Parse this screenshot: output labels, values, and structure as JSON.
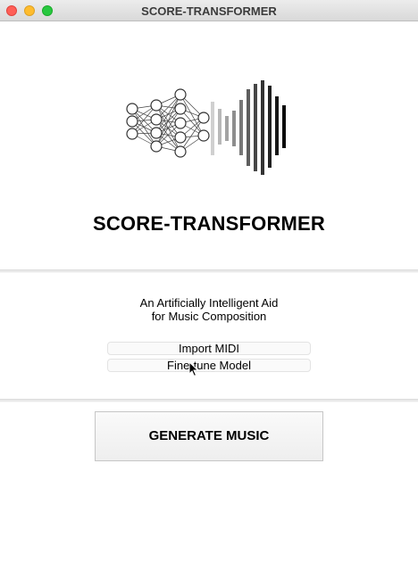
{
  "window": {
    "title": "SCORE-TRANSFORMER"
  },
  "app": {
    "heading": "SCORE-TRANSFORMER",
    "subtitle_line1": "An Artificially Intelligent Aid",
    "subtitle_line2": "for Music Composition"
  },
  "actions": {
    "import_label": "Import MIDI",
    "finetune_label": "Fine-tune Model",
    "generate_label": "GENERATE MUSIC"
  },
  "icons": {
    "logo": "neural-network-waveform-logo",
    "cursor": "mouse-pointer-icon"
  }
}
